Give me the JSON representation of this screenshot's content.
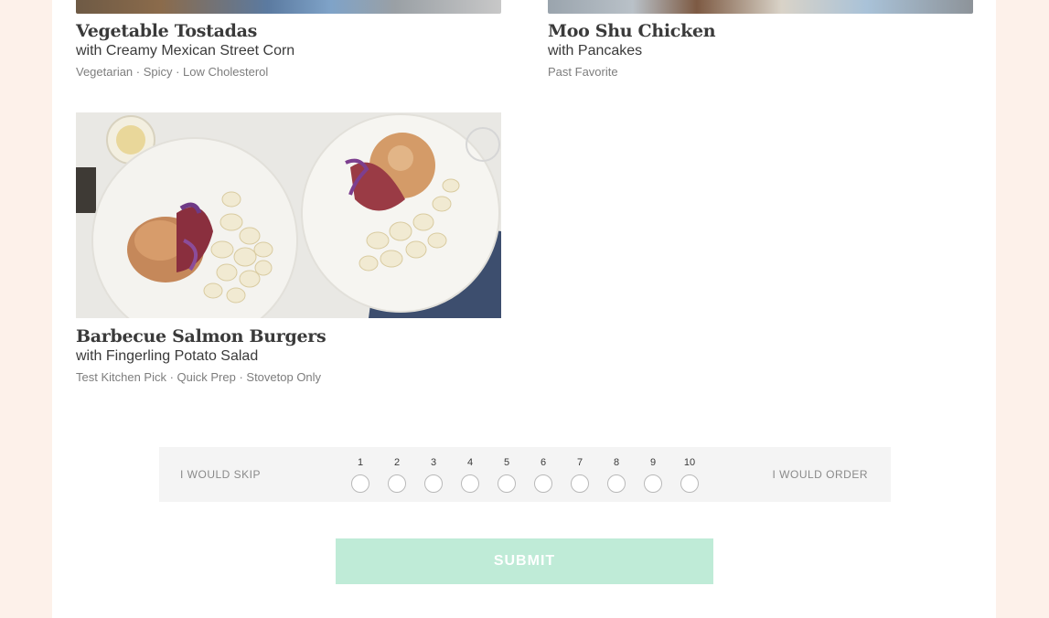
{
  "meals": [
    {
      "title": "Vegetable Tostadas",
      "subtitle": "with Creamy Mexican Street Corn",
      "tags": "Vegetarian · Spicy · Low Cholesterol"
    },
    {
      "title": "Moo Shu Chicken",
      "subtitle": "with Pancakes",
      "tags": "Past Favorite"
    },
    {
      "title": "Barbecue Salmon Burgers",
      "subtitle": "with Fingerling Potato Salad",
      "tags": "Test Kitchen Pick · Quick Prep · Stovetop Only"
    }
  ],
  "rating": {
    "left_label": "I WOULD SKIP",
    "right_label": "I WOULD ORDER",
    "options": [
      "1",
      "2",
      "3",
      "4",
      "5",
      "6",
      "7",
      "8",
      "9",
      "10"
    ]
  },
  "submit_label": "SUBMIT",
  "colors": {
    "page_background": "#fdf1ea",
    "submit_background": "#bfebd7",
    "rating_background": "#f4f4f4"
  }
}
